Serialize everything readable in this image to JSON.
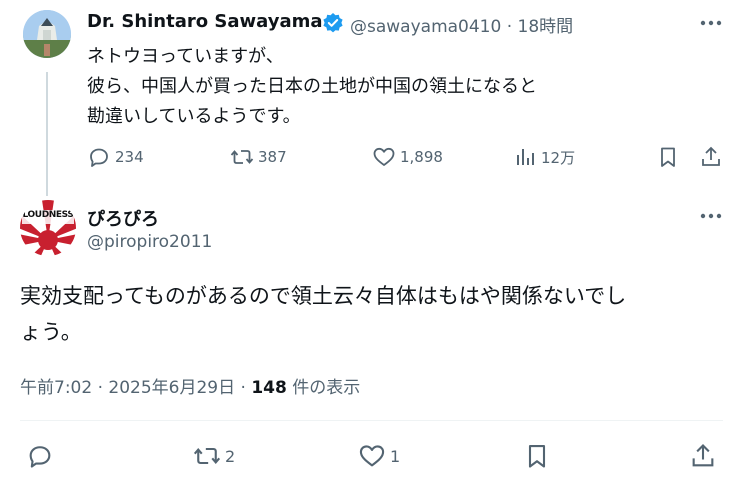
{
  "original_tweet": {
    "author_name": "Dr. Shintaro Sawayama",
    "handle": "@sawayama0410",
    "separator": "·",
    "time": "18時間",
    "text_lines": [
      "ネトウヨっていますが、",
      "彼ら、中国人が買った日本の土地が中国の領土になると",
      "勘違いしているようです。"
    ],
    "replies": "234",
    "reposts": "387",
    "likes": "1,898",
    "views": "12万",
    "verified": true,
    "icons": [
      "more-icon",
      "reply-icon",
      "repost-icon",
      "like-icon",
      "views-icon",
      "bookmark-icon",
      "share-icon",
      "verified-badge-icon"
    ]
  },
  "reply_tweet": {
    "author_name": "ぴろぴろ",
    "handle": "@piropiro2011",
    "avatar_text": "LOUDNESS",
    "text_lines": [
      "実効支配ってものがあるので領土云々自体はもはや関係ないでし",
      "ょう。"
    ],
    "time": "午前7:02",
    "separator1": "·",
    "date": "2025年6月29日",
    "separator2": "·",
    "view_count": "148",
    "view_label": "件の表示",
    "replies": "",
    "reposts": "2",
    "likes": "1"
  },
  "colors": {
    "text": "#0f1419",
    "secondary": "#536471",
    "verified": "#1d9bf0",
    "divider": "#eff3f4"
  }
}
